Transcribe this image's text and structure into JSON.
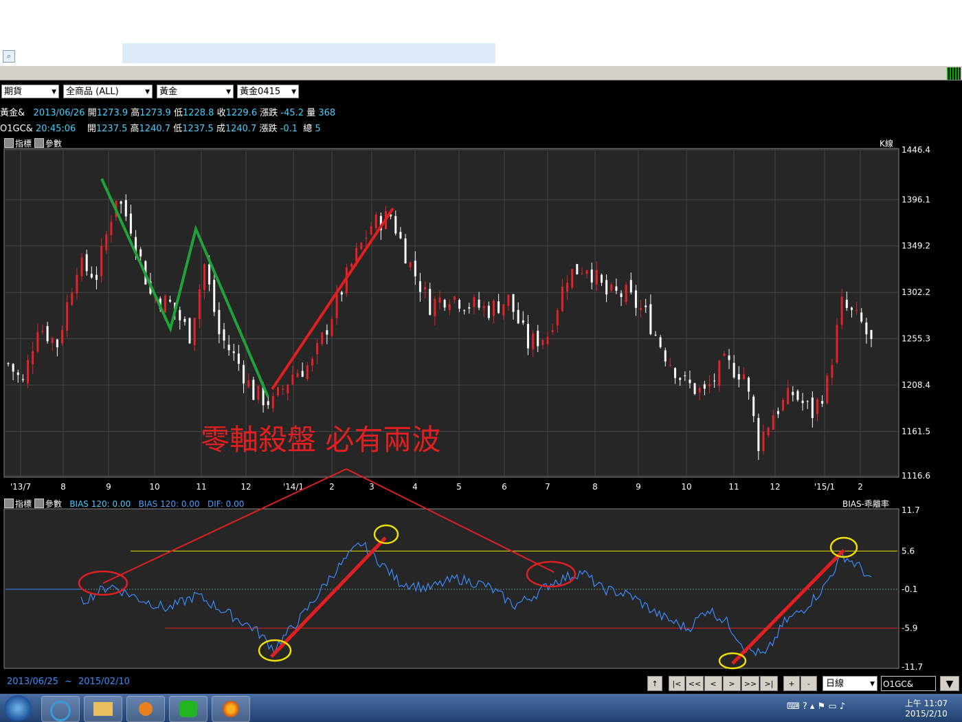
{
  "toolbar": {
    "market": "期貨",
    "category": "全商品 (ALL)",
    "commodity": "黃金",
    "contract": "黃金0415"
  },
  "quote1": {
    "name": "黃金&",
    "date": "2013/06/26",
    "open_label": "開",
    "open": "1273.9",
    "high_label": "高",
    "high": "1273.9",
    "low_label": "低",
    "low": "1228.8",
    "close_label": "收",
    "close": "1229.6",
    "chg_label": "漲跌",
    "chg": "-45.2",
    "vol_label": "量",
    "vol": "368"
  },
  "quote2": {
    "name": "O1GC&",
    "time": "20:45:06",
    "open_label": "開",
    "open": "1237.5",
    "high_label": "高",
    "high": "1240.7",
    "low_label": "低",
    "low": "1237.5",
    "close_label": "成",
    "close": "1240.7",
    "chg_label": "漲跌",
    "chg": "-0.1",
    "vol_label": "總",
    "vol": "5"
  },
  "panel1": {
    "hdr_a": "指標",
    "hdr_b": "參數",
    "right": "K線"
  },
  "panel2": {
    "hdr_a": "指標",
    "hdr_b": "參數",
    "b1": "BIAS 120: 0.00",
    "b2": "BIAS 120: 0.00",
    "dif": "DIF: 0.00",
    "right": "BIAS-乖離率"
  },
  "annotation": "零軸殺盤 必有兩波",
  "daterange": {
    "from": "2013/06/25",
    "sep": "~",
    "to": "2015/02/10"
  },
  "nav": {
    "b1": "↑",
    "b2": "|<",
    "b3": "<<",
    "b4": "<",
    "b5": ">",
    "b6": ">>",
    "b7": ">|",
    "zin": "+",
    "zout": "-",
    "period": "日線",
    "symbol": "O1GC&"
  },
  "clock": {
    "time": "上午 11:07",
    "date": "2015/2/10"
  },
  "colors": {
    "up": "#e0242a",
    "down": "#ffffff",
    "bias": "#3a8cff",
    "green": "#1fa23a",
    "red": "#e02020",
    "yellow": "#f0e000"
  },
  "chart_data": [
    {
      "type": "candlestick",
      "x_ticks": [
        "'13/7",
        "8",
        "9",
        "10",
        "11",
        "12",
        "'14/1",
        "2",
        "3",
        "4",
        "5",
        "6",
        "7",
        "8",
        "9",
        "10",
        "11",
        "12",
        "'15/1",
        "2"
      ],
      "y_ticks": [
        1446.4,
        1396.1,
        1349.2,
        1302.2,
        1255.3,
        1208.4,
        1161.5,
        1116.6
      ],
      "ylim": [
        1116.6,
        1446.4
      ],
      "close_path": [
        [
          0,
          1230
        ],
        [
          3,
          1210
        ],
        [
          6,
          1270
        ],
        [
          10,
          1250
        ],
        [
          14,
          1330
        ],
        [
          18,
          1320
        ],
        [
          22,
          1400
        ],
        [
          25,
          1370
        ],
        [
          29,
          1300
        ],
        [
          33,
          1290
        ],
        [
          37,
          1260
        ],
        [
          40,
          1330
        ],
        [
          43,
          1260
        ],
        [
          47,
          1230
        ],
        [
          50,
          1200
        ],
        [
          54,
          1190
        ],
        [
          58,
          1220
        ],
        [
          62,
          1230
        ],
        [
          66,
          1280
        ],
        [
          70,
          1330
        ],
        [
          74,
          1370
        ],
        [
          78,
          1380
        ],
        [
          82,
          1330
        ],
        [
          86,
          1290
        ],
        [
          90,
          1300
        ],
        [
          94,
          1290
        ],
        [
          98,
          1285
        ],
        [
          102,
          1295
        ],
        [
          106,
          1250
        ],
        [
          110,
          1260
        ],
        [
          114,
          1320
        ],
        [
          118,
          1330
        ],
        [
          122,
          1300
        ],
        [
          126,
          1300
        ],
        [
          130,
          1280
        ],
        [
          134,
          1240
        ],
        [
          138,
          1210
        ],
        [
          142,
          1200
        ],
        [
          146,
          1230
        ],
        [
          150,
          1220
        ],
        [
          153,
          1150
        ],
        [
          156,
          1180
        ],
        [
          160,
          1200
        ],
        [
          164,
          1180
        ],
        [
          167,
          1210
        ],
        [
          170,
          1290
        ],
        [
          174,
          1270
        ],
        [
          176,
          1250
        ]
      ],
      "total_bars": 176
    },
    {
      "type": "line",
      "series": [
        {
          "name": "BIAS 120",
          "points": [
            [
              16,
              -2
            ],
            [
              22,
              0.5
            ],
            [
              28,
              -1.5
            ],
            [
              34,
              -3
            ],
            [
              40,
              -1
            ],
            [
              46,
              -3.5
            ],
            [
              52,
              -6
            ],
            [
              56,
              -9
            ],
            [
              62,
              -4
            ],
            [
              68,
              2
            ],
            [
              74,
              6.8
            ],
            [
              78,
              4
            ],
            [
              82,
              1
            ],
            [
              88,
              0
            ],
            [
              94,
              1.5
            ],
            [
              100,
              0.5
            ],
            [
              106,
              -2.5
            ],
            [
              110,
              -1
            ],
            [
              114,
              1
            ],
            [
              120,
              2.5
            ],
            [
              124,
              0
            ],
            [
              130,
              -1
            ],
            [
              136,
              -4
            ],
            [
              142,
              -6
            ],
            [
              146,
              -3
            ],
            [
              150,
              -5
            ],
            [
              154,
              -9
            ],
            [
              158,
              -10
            ],
            [
              162,
              -5
            ],
            [
              166,
              -3
            ],
            [
              170,
              0
            ],
            [
              174,
              5
            ],
            [
              178,
              3
            ],
            [
              180,
              1
            ]
          ]
        }
      ],
      "y_ticks": [
        11.7,
        5.6,
        -0.1,
        -5.9,
        -11.7
      ],
      "ylim": [
        -11.7,
        11.7
      ],
      "ref_lines": [
        5.6,
        -0.1,
        -5.9
      ]
    }
  ]
}
